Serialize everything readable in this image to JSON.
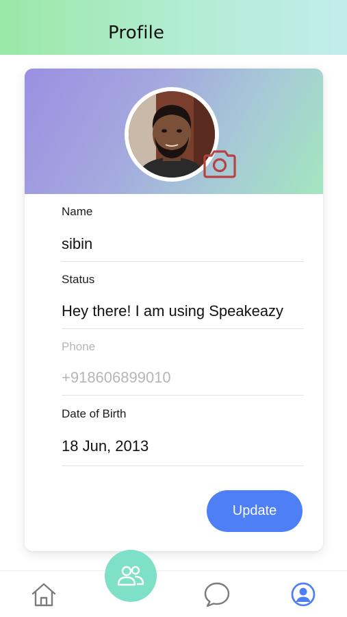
{
  "header": {
    "title": "Profile"
  },
  "profile": {
    "fields": [
      {
        "label": "Name",
        "value": "sibin",
        "editable": true
      },
      {
        "label": "Status",
        "value": "Hey there! I am using Speakeazy",
        "editable": true
      },
      {
        "label": "Phone",
        "value": "+918606899010",
        "editable": false
      },
      {
        "label": "Date of Birth",
        "value": "18 Jun, 2013",
        "editable": true
      }
    ],
    "update_label": "Update"
  },
  "nav": {
    "items": [
      {
        "icon": "home-icon"
      },
      {
        "icon": "contacts-icon",
        "active_color": "#7ee0c7"
      },
      {
        "icon": "chat-icon"
      },
      {
        "icon": "profile-icon",
        "active_color": "#4f7ff5"
      }
    ]
  },
  "colors": {
    "accent": "#4f7ff5",
    "camera": "#b8423e",
    "header_gradient": [
      "#9ae8a6",
      "#c2eceb"
    ],
    "banner_gradient": [
      "#9c8fe2",
      "#a3e6be"
    ]
  }
}
